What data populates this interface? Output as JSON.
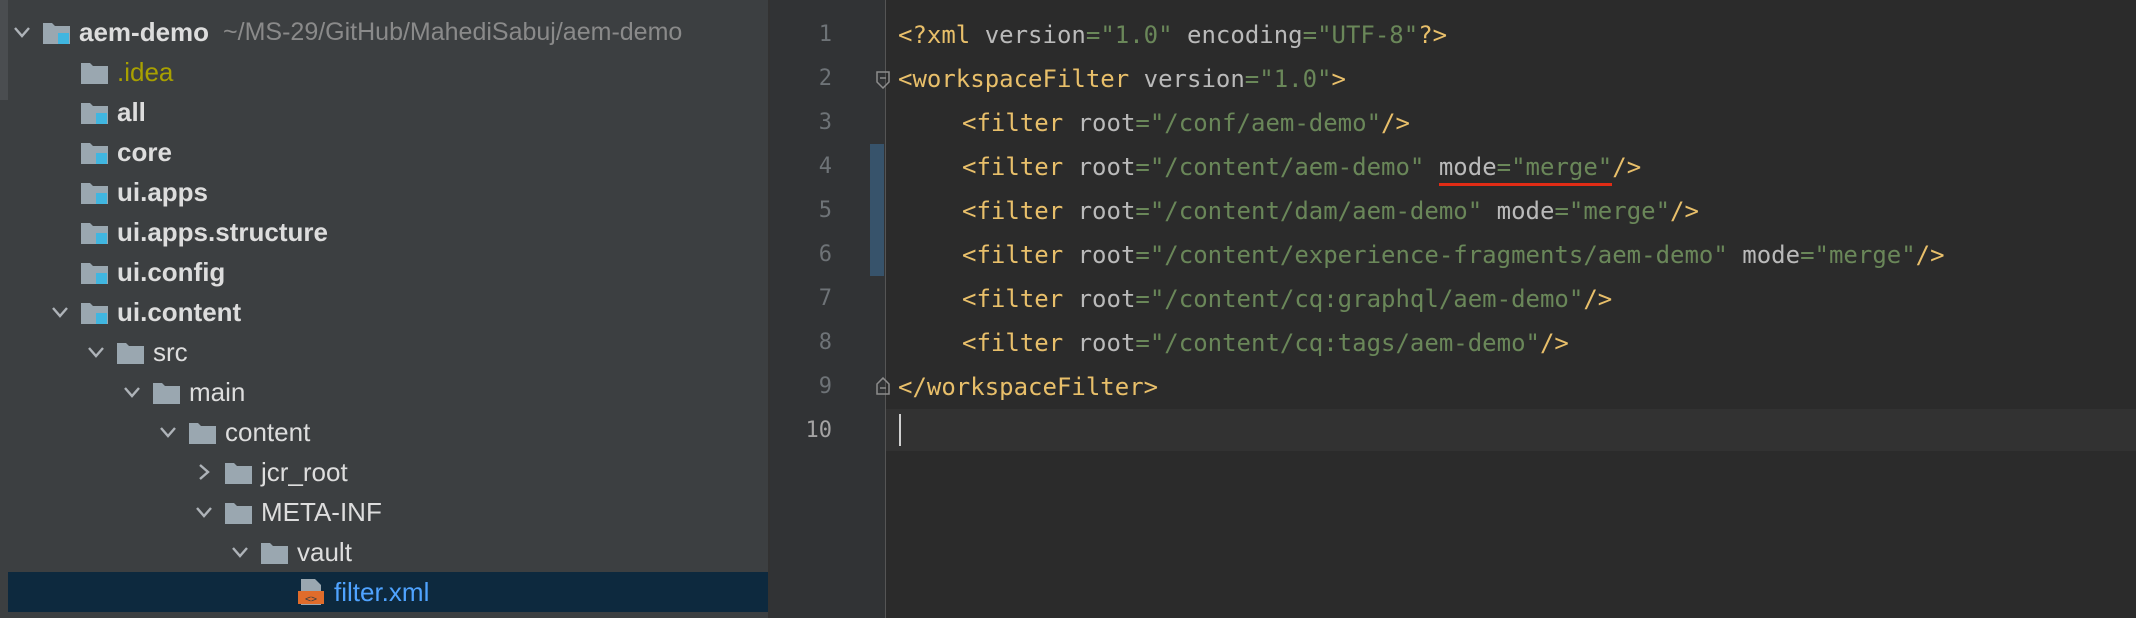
{
  "project_tree": {
    "root": {
      "name": "aem-demo",
      "path": "~/MS-29/GitHub/MahediSabuj/aem-demo"
    },
    "items": [
      {
        "label": ".idea",
        "style": "excluded",
        "expanded": false
      },
      {
        "label": "all",
        "style": "module",
        "expanded": false
      },
      {
        "label": "core",
        "style": "module",
        "expanded": false
      },
      {
        "label": "ui.apps",
        "style": "module",
        "expanded": false
      },
      {
        "label": "ui.apps.structure",
        "style": "module",
        "expanded": false
      },
      {
        "label": "ui.config",
        "style": "module",
        "expanded": false
      },
      {
        "label": "ui.content",
        "style": "module",
        "expanded": true
      },
      {
        "label": "src",
        "style": "folder",
        "expanded": true
      },
      {
        "label": "main",
        "style": "folder",
        "expanded": true
      },
      {
        "label": "content",
        "style": "folder",
        "expanded": true
      },
      {
        "label": "jcr_root",
        "style": "folder",
        "expanded": false
      },
      {
        "label": "META-INF",
        "style": "folder",
        "expanded": true
      },
      {
        "label": "vault",
        "style": "folder",
        "expanded": true
      },
      {
        "label": "filter.xml",
        "style": "file",
        "selected": true
      }
    ]
  },
  "editor": {
    "file": "filter.xml",
    "current_line": 10,
    "line_numbers": [
      "1",
      "2",
      "3",
      "4",
      "5",
      "6",
      "7",
      "8",
      "9",
      "10"
    ],
    "code": {
      "l1": {
        "open": "<?xml ",
        "a1": "version",
        "eq1": "=",
        "v1": "\"1.0\"",
        "sp": " ",
        "a2": "encoding",
        "eq2": "=",
        "v2": "\"UTF-8\"",
        "close": "?>"
      },
      "l2": {
        "open": "<workspaceFilter ",
        "a1": "version",
        "eq1": "=",
        "v1": "\"1.0\"",
        "close": ">"
      },
      "l3": {
        "open": "<filter ",
        "a1": "root",
        "eq1": "=",
        "v1": "\"/conf/aem-demo\"",
        "close": "/>"
      },
      "l4": {
        "open": "<filter ",
        "a1": "root",
        "eq1": "=",
        "v1": "\"/content/aem-demo\"",
        "sp": " ",
        "a2": "mode",
        "eq2": "=",
        "v2": "\"merge\"",
        "close": "/>"
      },
      "l5": {
        "open": "<filter ",
        "a1": "root",
        "eq1": "=",
        "v1": "\"/content/dam/aem-demo\"",
        "sp": " ",
        "a2": "mode",
        "eq2": "=",
        "v2": "\"merge\"",
        "close": "/>"
      },
      "l6": {
        "open": "<filter ",
        "a1": "root",
        "eq1": "=",
        "v1": "\"/content/experience-fragments/aem-demo\"",
        "sp": " ",
        "a2": "mode",
        "eq2": "=",
        "v2": "\"merge\"",
        "close": "/>"
      },
      "l7": {
        "open": "<filter ",
        "a1": "root",
        "eq1": "=",
        "v1": "\"/content/cq:graphql/aem-demo\"",
        "close": "/>"
      },
      "l8": {
        "open": "<filter ",
        "a1": "root",
        "eq1": "=",
        "v1": "\"/content/cq:tags/aem-demo\"",
        "close": "/>"
      },
      "l9": {
        "close": "</workspaceFilter>"
      }
    }
  },
  "colors": {
    "tree_bg": "#3c3f41",
    "selection": "#0d293e",
    "editor_bg": "#2b2b2b",
    "tag": "#e8bf6a",
    "attribute": "#bababa",
    "string": "#6a8759",
    "highlight_underline": "#e12c15",
    "excluded_folder": "#a8a000",
    "file_name": "#4fa3ff"
  }
}
